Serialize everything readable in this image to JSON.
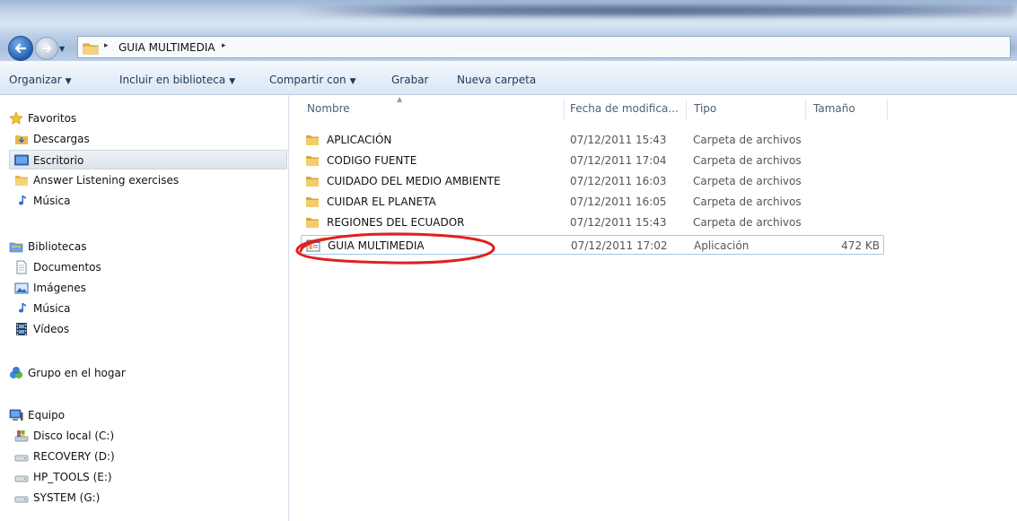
{
  "address": {
    "path": "GUIA MULTIMEDIA",
    "separator": "▸"
  },
  "toolbar": {
    "organize": "Organizar",
    "include_library": "Incluir en biblioteca",
    "share_with": "Compartir con",
    "burn": "Grabar",
    "new_folder": "Nueva carpeta"
  },
  "nav": {
    "favorites": {
      "title": "Favoritos",
      "items": [
        "Descargas",
        "Escritorio",
        "Answer Listening exercises",
        "Música"
      ]
    },
    "libraries": {
      "title": "Bibliotecas",
      "items": [
        "Documentos",
        "Imágenes",
        "Música",
        "Vídeos"
      ]
    },
    "homegroup": "Grupo en el hogar",
    "computer": {
      "title": "Equipo",
      "items": [
        "Disco local (C:)",
        "RECOVERY (D:)",
        "HP_TOOLS (E:)",
        "SYSTEM (G:)"
      ]
    }
  },
  "columns": {
    "name": "Nombre",
    "date": "Fecha de modifica...",
    "type": "Tipo",
    "size": "Tamaño"
  },
  "files": [
    {
      "name": "APLICACIÓN",
      "date": "07/12/2011 15:43",
      "type": "Carpeta de archivos",
      "size": ""
    },
    {
      "name": "CODIGO FUENTE",
      "date": "07/12/2011 17:04",
      "type": "Carpeta de archivos",
      "size": ""
    },
    {
      "name": "CUIDADO DEL MEDIO AMBIENTE",
      "date": "07/12/2011 16:03",
      "type": "Carpeta de archivos",
      "size": ""
    },
    {
      "name": "CUIDAR EL PLANETA",
      "date": "07/12/2011 16:05",
      "type": "Carpeta de archivos",
      "size": ""
    },
    {
      "name": "REGIONES DEL ECUADOR",
      "date": "07/12/2011 15:43",
      "type": "Carpeta de archivos",
      "size": ""
    },
    {
      "name": "GUIA MULTIMEDIA",
      "date": "07/12/2011 17:02",
      "type": "Aplicación",
      "size": "472 KB"
    }
  ],
  "colors": {
    "annotation": "#e02020",
    "folder": "#e8b84a"
  }
}
